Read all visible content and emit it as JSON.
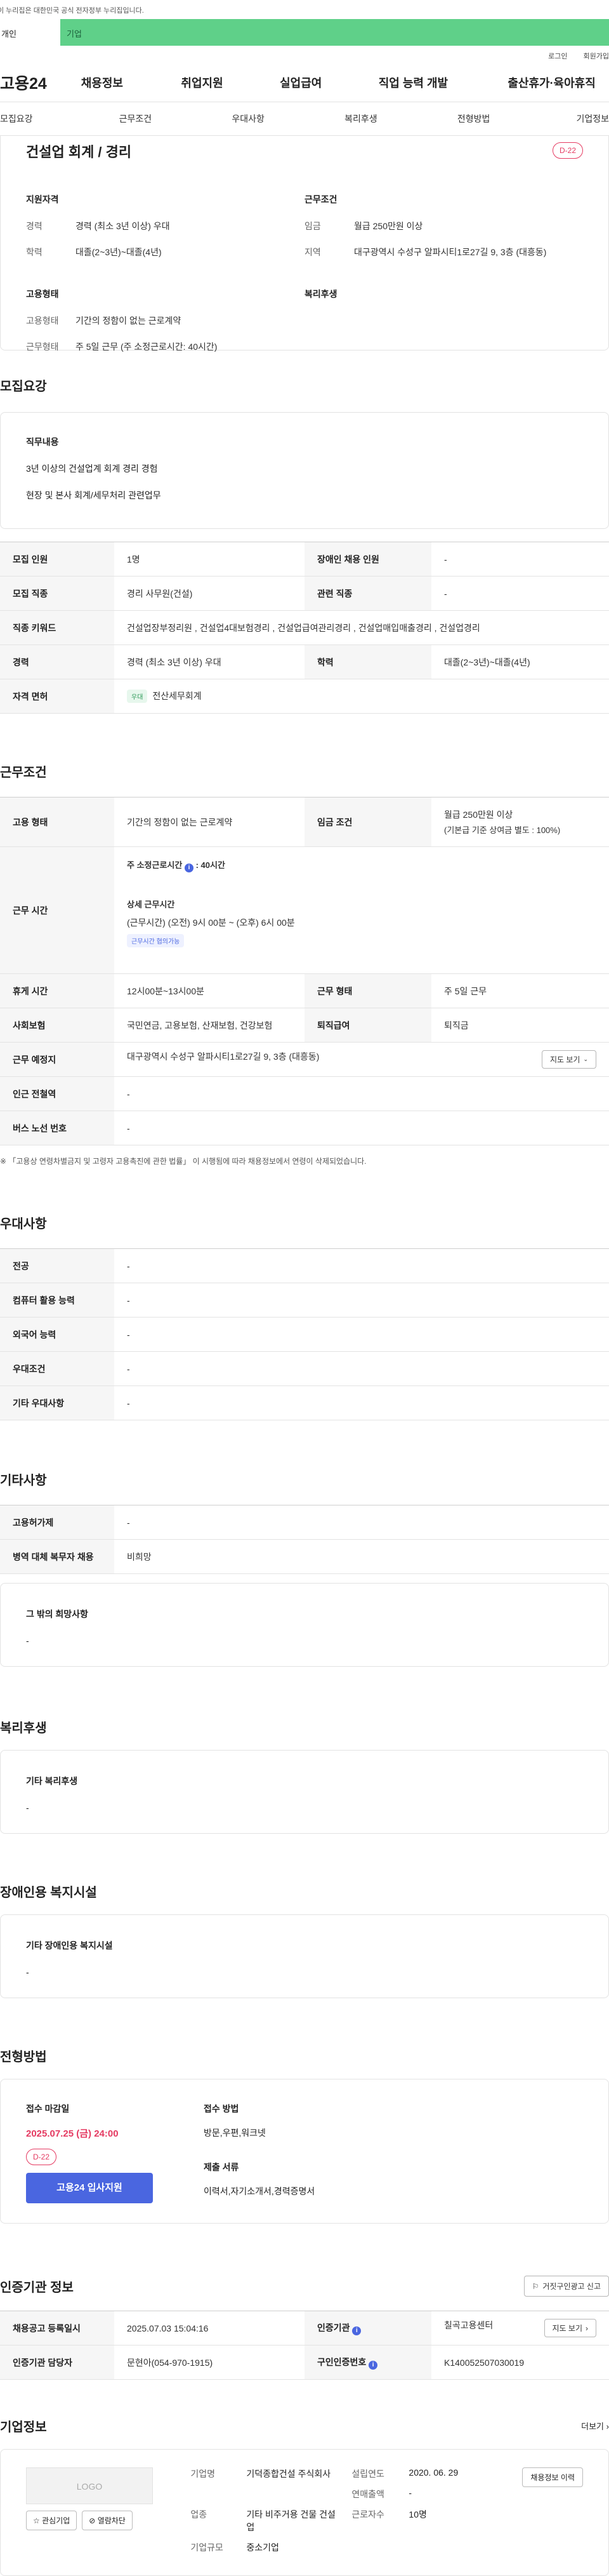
{
  "header": {
    "gov_notice": "이 누리집은 대한민국 공식 전자정부 누리집입니다.",
    "tab_person": "개인",
    "tab_corp": "기업",
    "login": "로그인",
    "join": "회원가입",
    "logo": "고용24",
    "menu": [
      "채용정보",
      "취업지원",
      "실업급여",
      "직업 능력 개발",
      "출산휴가·육아휴직"
    ]
  },
  "subnav": [
    "모집요강",
    "근무조건",
    "우대사항",
    "복리후생",
    "전형방법",
    "기업정보"
  ],
  "summary": {
    "title": "건설업 회계 / 경리",
    "dday": "D-22",
    "qual_title": "지원자격",
    "work_title": "근무조건",
    "emp_title": "고용형태",
    "welfare_title": "복리후생",
    "career_k": "경력",
    "career_v": "경력 (최소 3년 이상) 우대",
    "edu_k": "학력",
    "edu_v": "대졸(2~3년)~대졸(4년)",
    "wage_k": "임금",
    "wage_v": "월급 250만원 이상",
    "area_k": "지역",
    "area_v": "대구광역시 수성구 알파시티1로27길 9, 3층 (대흥동)",
    "type_k": "고용형태",
    "type_v": "기간의 정함이 없는 근로계약",
    "hours_k": "근무형태",
    "hours_v": "주 5일 근무 (주 소정근로시간: 40시간)"
  },
  "recruit": {
    "title": "모집요강",
    "job_label": "직무내용",
    "job_line1": "3년 이상의 건설업계 회계 경리 경험",
    "job_line2": "현장 및 본사 회계/세무처리 관련업무",
    "count_k": "모집 인원",
    "count_v": "1명",
    "disabled_k": "장애인 채용 인원",
    "disabled_v": "-",
    "job_k": "모집 직종",
    "job_v": "경리 사무원(건설)",
    "rel_k": "관련 직종",
    "rel_v": "-",
    "kw_k": "직종 키워드",
    "kw_v": "건설업장부정리원 , 건설업4대보험경리 , 건설업급여관리경리 , 건설업매입매출경리 , 건설업경리",
    "career_k": "경력",
    "career_v": "경력 (최소 3년 이상) 우대",
    "edu_k": "학력",
    "edu_v": "대졸(2~3년)~대졸(4년)",
    "license_k": "자격 면허",
    "license_tag": "우대",
    "license_v": "전산세무회계"
  },
  "work": {
    "title": "근무조건",
    "type_k": "고용 형태",
    "type_v": "기간의 정함이 없는 근로계약",
    "wage_k": "임금 조건",
    "wage_v1": "월급 250만원 이상",
    "wage_v2": "(기본급 기준 상여금 별도 : 100%)",
    "time_k": "근무 시간",
    "time_main": "주 소정근로시간",
    "time_main_v": ": 40시간",
    "time_detail": "상세 근무시간",
    "time_detail_v": "(근무시간) (오전) 9시 00분 ~ (오후) 6시 00분",
    "time_badge": "근무시간 협의가능",
    "rest_k": "휴게 시간",
    "rest_v": "12시00분~13시00분",
    "form_k": "근무 형태",
    "form_v": "주 5일 근무",
    "ins_k": "사회보험",
    "ins_v": "국민연금, 고용보험, 산재보험, 건강보험",
    "retire_k": "퇴직급여",
    "retire_v": "퇴직금",
    "place_k": "근무 예정지",
    "place_v": "대구광역시 수성구 알파시티1로27길 9, 3층 (대흥동)",
    "map_btn": "지도 보기",
    "subway_k": "인근 전철역",
    "subway_v": "-",
    "bus_k": "버스 노선 번호",
    "bus_v": "-",
    "note": "※ 「고용상 연령차별금지 및 고령자 고용촉진에 관한 법률」 이 시행됨에 따라 채용정보에서 연령이 삭제되었습니다."
  },
  "prefer": {
    "title": "우대사항",
    "rows": [
      {
        "k": "전공",
        "v": "-"
      },
      {
        "k": "컴퓨터 활용 능력",
        "v": "-"
      },
      {
        "k": "외국어 능력",
        "v": "-"
      },
      {
        "k": "우대조건",
        "v": "-"
      },
      {
        "k": "기타 우대사항",
        "v": "-"
      }
    ]
  },
  "etc": {
    "title": "기타사항",
    "rows": [
      {
        "k": "고용허가제",
        "v": "-"
      },
      {
        "k": "병역 대체 복무자 채용",
        "v": "비희망"
      }
    ],
    "other_label": "그 밖의 희망사항",
    "other_v": "-"
  },
  "welfare": {
    "title": "복리후생",
    "label": "기타 복리후생",
    "v": "-"
  },
  "disabled": {
    "title": "장애인용 복지시설",
    "label": "기타 장애인용 복지시설",
    "v": "-"
  },
  "process": {
    "title": "전형방법",
    "deadline_label": "접수 마감일",
    "deadline_v": "2025.07.25 (금) 24:00",
    "dday": "D-22",
    "submit": "고용24 입사지원",
    "method_label": "접수 방법",
    "method_v": "방문,우편,워크넷",
    "docs_label": "제출 서류",
    "docs_v": "이력서,자기소개서,경력증명서"
  },
  "cert": {
    "title": "인증기관 정보",
    "report_btn": "거짓구인광고 신고",
    "reg_k": "채용공고 등록일시",
    "reg_v": "2025.07.03 15:04:16",
    "org_k": "인증기관",
    "org_v": "칠곡고용센터",
    "map_btn": "지도 보기",
    "staff_k": "인증기관 담당자",
    "staff_v": "문현아(054-970-1915)",
    "id_k": "구인인증번호",
    "id_v": "K140052507030019"
  },
  "company": {
    "title": "기업정보",
    "more": "더보기",
    "logo": "LOGO",
    "fav": "관심기업",
    "block": "열람차단",
    "name_k": "기업명",
    "name_v": "기덕종합건설 주식회사",
    "found_k": "설립연도",
    "found_v": "2020. 06. 29",
    "sales_k": "연매출액",
    "sales_v": "-",
    "biz_k": "업종",
    "biz_v": "기타 비주거용 건물 건설업",
    "emp_k": "근로자수",
    "emp_v": "10명",
    "size_k": "기업규모",
    "size_v": "중소기업",
    "jobs_btn": "채용정보 이력"
  }
}
